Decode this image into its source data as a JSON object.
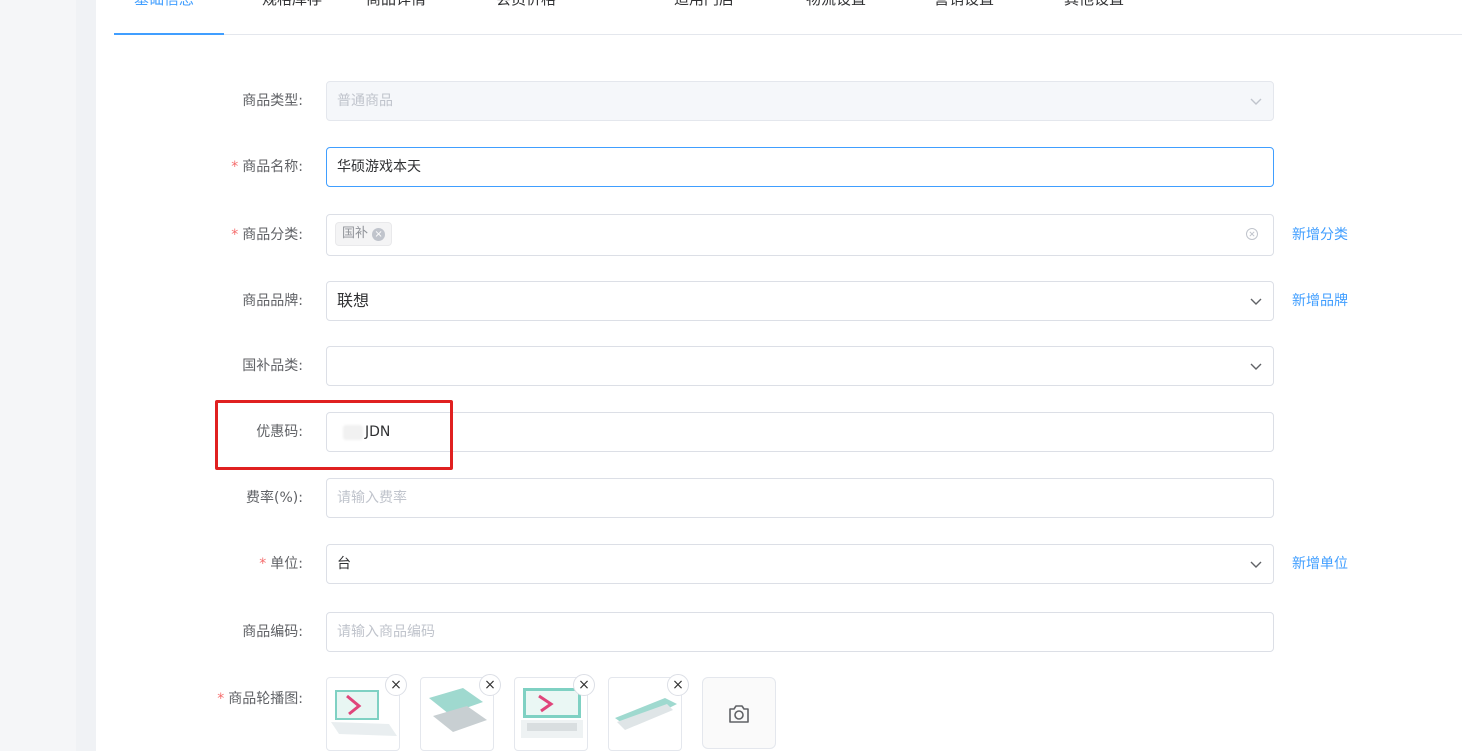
{
  "tabs": [
    {
      "label": "基础信息",
      "active": true
    },
    {
      "label": "规格库存",
      "active": false
    },
    {
      "label": "商品详情",
      "active": false
    },
    {
      "label": "会员价格",
      "active": false
    },
    {
      "label": "适用门店",
      "active": false
    },
    {
      "label": "物流设置",
      "active": false
    },
    {
      "label": "营销设置",
      "active": false
    },
    {
      "label": "其他设置",
      "active": false
    }
  ],
  "form": {
    "product_type": {
      "label": "商品类型:",
      "value": "普通商品"
    },
    "product_name": {
      "label": "商品名称:",
      "required": "*",
      "value": "华硕游戏本天"
    },
    "category": {
      "label": "商品分类:",
      "required": "*",
      "tag": "国补",
      "side_link": "新增分类"
    },
    "brand": {
      "label": "商品品牌:",
      "value": "联想",
      "side_link": "新增品牌"
    },
    "subsidy_category": {
      "label": "国补品类:",
      "value": ""
    },
    "coupon_code": {
      "label": "优惠码:",
      "value": "JDN"
    },
    "fee_rate": {
      "label": "费率(%):",
      "placeholder": "请输入费率"
    },
    "unit": {
      "label": "单位:",
      "required": "*",
      "value": "台",
      "side_link": "新增单位"
    },
    "product_code": {
      "label": "商品编码:",
      "placeholder": "请输入商品编码"
    },
    "carousel": {
      "label": "商品轮播图:",
      "required": "*",
      "remove_symbol": "×"
    }
  },
  "colors": {
    "primary": "#409eff",
    "required": "#f56c6c",
    "highlight": "#e02020"
  }
}
